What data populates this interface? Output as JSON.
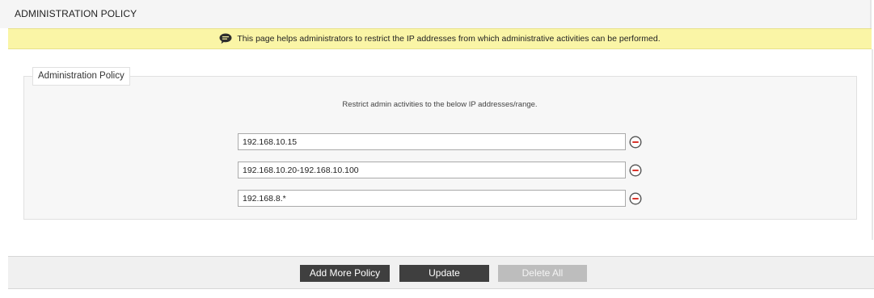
{
  "page": {
    "title": "ADMINISTRATION POLICY"
  },
  "notice": {
    "icon": "speech-bubble-icon",
    "text": "This page helps administrators to restrict the IP addresses from which administrative activities can be performed."
  },
  "section": {
    "legend": "Administration Policy",
    "description": "Restrict admin activities to the below IP addresses/range."
  },
  "ip_entries": [
    {
      "value": "192.168.10.15"
    },
    {
      "value": "192.168.10.20-192.168.10.100"
    },
    {
      "value": "192.168.8.*"
    }
  ],
  "remove_icon": "minus-circle-icon",
  "buttons": {
    "add_more": "Add More Policy",
    "update": "Update",
    "delete_all": "Delete All"
  },
  "colors": {
    "notice_bg": "#faf5a6",
    "remove_icon_red": "#d9342b",
    "button_dark": "#3f3f3f",
    "button_disabled": "#bdbdbd"
  }
}
